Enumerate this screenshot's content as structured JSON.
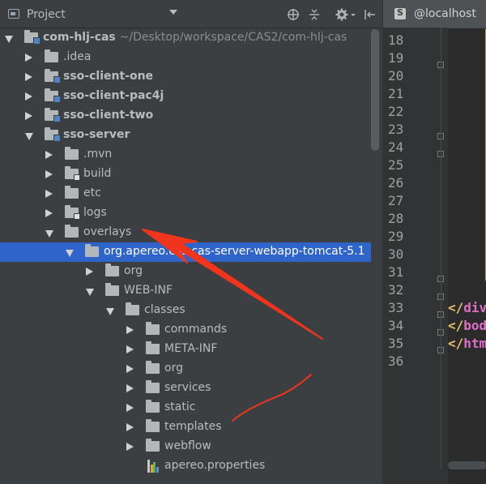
{
  "project_panel": {
    "title": "Project",
    "root": {
      "name": "com-hlj-cas",
      "path": "~/Desktop/workspace/CAS2/com-hlj-cas"
    }
  },
  "tree": [
    {
      "label": "com-hlj-cas",
      "path": "~/Desktop/workspace/CAS2/com-hlj-cas",
      "depth": 0,
      "arrow": "down",
      "folder": "module",
      "bold": true
    },
    {
      "label": ".idea",
      "depth": 1,
      "arrow": "right",
      "folder": "plain",
      "bold": false
    },
    {
      "label": "sso-client-one",
      "depth": 1,
      "arrow": "right",
      "folder": "module",
      "bold": true
    },
    {
      "label": "sso-client-pac4j",
      "depth": 1,
      "arrow": "right",
      "folder": "module",
      "bold": true
    },
    {
      "label": "sso-client-two",
      "depth": 1,
      "arrow": "right",
      "folder": "module",
      "bold": true
    },
    {
      "label": "sso-server",
      "depth": 1,
      "arrow": "down",
      "folder": "module",
      "bold": true
    },
    {
      "label": ".mvn",
      "depth": 2,
      "arrow": "right",
      "folder": "plain",
      "bold": false
    },
    {
      "label": "build",
      "depth": 2,
      "arrow": "right",
      "folder": "locked",
      "bold": false
    },
    {
      "label": "etc",
      "depth": 2,
      "arrow": "right",
      "folder": "plain",
      "bold": false
    },
    {
      "label": "logs",
      "depth": 2,
      "arrow": "right",
      "folder": "locked",
      "bold": false
    },
    {
      "label": "overlays",
      "depth": 2,
      "arrow": "down",
      "folder": "plain",
      "bold": false
    },
    {
      "label": "org.apereo.cas.cas-server-webapp-tomcat-5.1",
      "depth": 3,
      "arrow": "down",
      "folder": "plain",
      "bold": false,
      "selected": true
    },
    {
      "label": "org",
      "depth": 4,
      "arrow": "right",
      "folder": "plain",
      "bold": false
    },
    {
      "label": "WEB-INF",
      "depth": 4,
      "arrow": "down",
      "folder": "plain",
      "bold": false
    },
    {
      "label": "classes",
      "depth": 5,
      "arrow": "down",
      "folder": "plain",
      "bold": false
    },
    {
      "label": "commands",
      "depth": 6,
      "arrow": "right",
      "folder": "plain",
      "bold": false
    },
    {
      "label": "META-INF",
      "depth": 6,
      "arrow": "right",
      "folder": "plain",
      "bold": false
    },
    {
      "label": "org",
      "depth": 6,
      "arrow": "right",
      "folder": "plain",
      "bold": false
    },
    {
      "label": "services",
      "depth": 6,
      "arrow": "right",
      "folder": "plain",
      "bold": false
    },
    {
      "label": "static",
      "depth": 6,
      "arrow": "right",
      "folder": "plain",
      "bold": false
    },
    {
      "label": "templates",
      "depth": 6,
      "arrow": "right",
      "folder": "plain",
      "bold": false
    },
    {
      "label": "webflow",
      "depth": 6,
      "arrow": "right",
      "folder": "plain",
      "bold": false
    },
    {
      "label": "apereo.properties",
      "depth": 6,
      "arrow": "none",
      "folder": "properties",
      "bold": false
    }
  ],
  "editor": {
    "tab_label": "@localhost",
    "line_numbers": [
      "18",
      "19",
      "20",
      "21",
      "22",
      "23",
      "24",
      "25",
      "26",
      "27",
      "28",
      "29",
      "30",
      "31",
      "32",
      "33",
      "34",
      "35",
      "36"
    ],
    "code_lines": [
      {
        "line": "33",
        "bracket": "</",
        "tag": "div"
      },
      {
        "line": "34",
        "bracket": "</",
        "tag": "body"
      },
      {
        "line": "35",
        "bracket": "</",
        "tag": "html"
      }
    ]
  },
  "colors": {
    "selection": "#2f65ca",
    "annotation_red": "#f0351c",
    "tree_text": "#bbbbbb",
    "editor_bg": "#2b2b2b",
    "tag_name": "#e06ec8",
    "tag_bracket": "#e8bf6a"
  },
  "icons": [
    "project-icon",
    "dropdown-icon",
    "locate-icon",
    "collapse-all-icon",
    "settings-icon",
    "hide-panel-icon",
    "folder-icon",
    "module-folder-icon",
    "locked-folder-icon",
    "properties-file-icon",
    "tab-file-icon",
    "fold-icon"
  ]
}
